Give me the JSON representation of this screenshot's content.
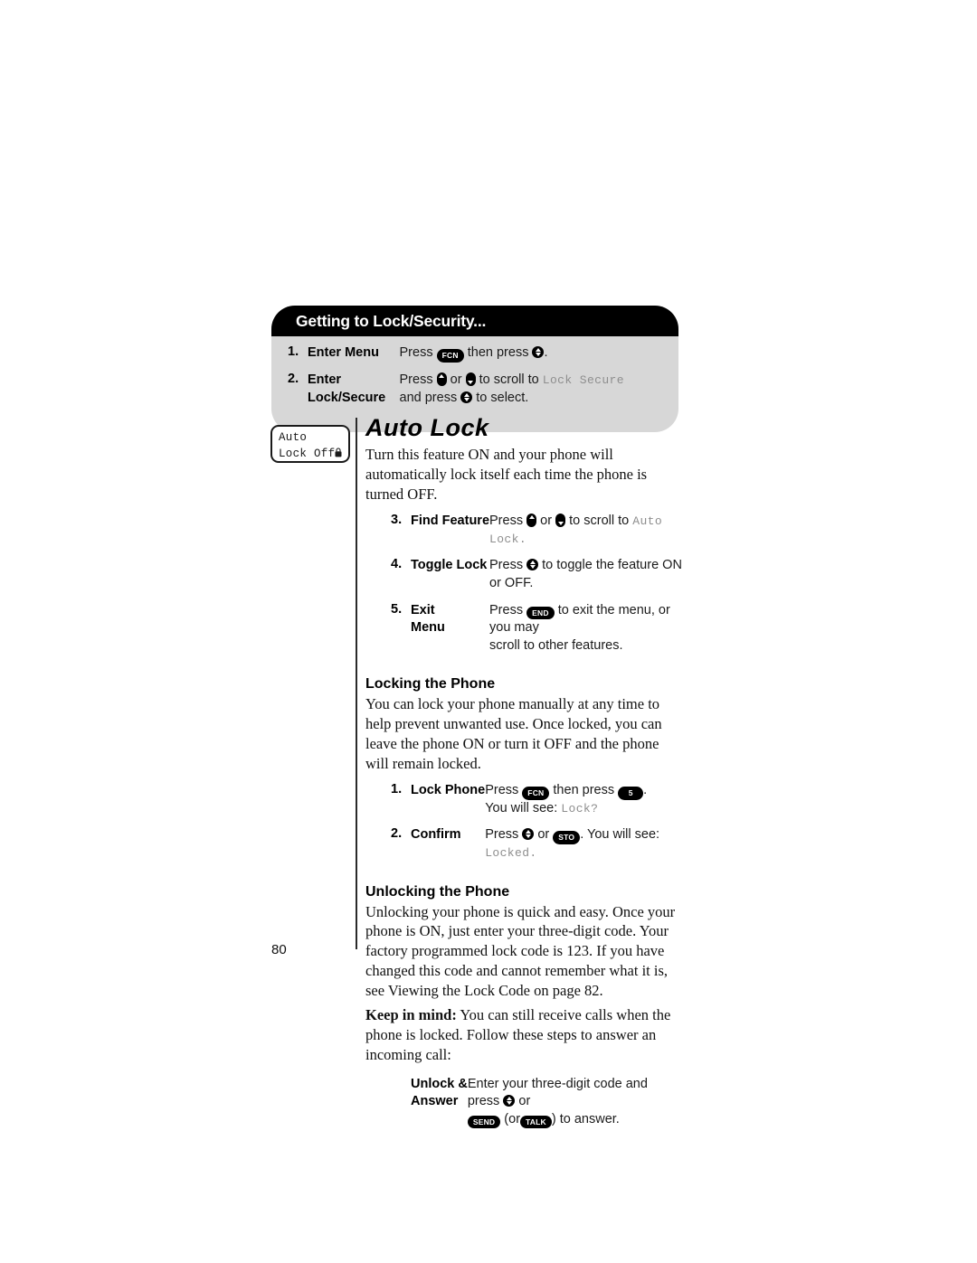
{
  "page": {
    "number": "80"
  },
  "callout": {
    "header": "Getting to Lock/Security...",
    "steps": [
      {
        "num": "1.",
        "label": "Enter Menu",
        "desc_pre": "Press",
        "key1": "FCN",
        "desc_mid": "then press",
        "desc_post": "."
      },
      {
        "num": "2.",
        "label_line1": "Enter",
        "label_line2": "Lock/Secure",
        "desc_pre": "Press",
        "desc_or": "or",
        "desc_scroll": "to scroll to",
        "lcd": "Lock Secure",
        "desc_line2_pre": "and press",
        "desc_line2_post": "to select."
      }
    ]
  },
  "phone_display": {
    "line1": "Auto",
    "line2": "Lock Off",
    "icon": "lock-icon"
  },
  "article": {
    "title": "Auto Lock",
    "intro": "Turn this feature ON and your phone will automatically lock itself each time the phone is turned OFF.",
    "steps": [
      {
        "num": "3.",
        "label": "Find Feature",
        "pre": "Press",
        "or": "or",
        "scroll": "to scroll to",
        "lcd": "Auto Lock",
        "post": "."
      },
      {
        "num": "4.",
        "label": "Toggle Lock",
        "pre": "Press",
        "post": "to toggle the feature ON or OFF."
      },
      {
        "num": "5.",
        "label_line1": "Exit",
        "label_line2": "Menu",
        "pre": "Press",
        "key": "END",
        "post": "to exit the menu, or you may",
        "line2": "scroll to other features."
      }
    ],
    "locking": {
      "heading": "Locking the Phone",
      "body": "You can lock your phone manually at any time to help prevent unwanted use. Once locked, you can leave the phone ON or turn it OFF and the phone will remain locked.",
      "steps": [
        {
          "num": "1.",
          "label": "Lock Phone",
          "pre": "Press",
          "key1": "FCN",
          "mid": "then press",
          "key2": "5",
          "post": ".",
          "line2_pre": "You will see:",
          "line2_lcd": "Lock?"
        },
        {
          "num": "2.",
          "label": "Confirm",
          "pre": "Press",
          "or": "or",
          "key": "STO",
          "mid": ". You will see:",
          "lcd": "Locked",
          "post": "."
        }
      ]
    },
    "unlocking": {
      "heading": "Unlocking the Phone",
      "body": "Unlocking your phone is quick and easy. Once your phone is ON, just enter your three-digit code. Your factory programmed lock code is 123. If you have changed this code and cannot remember what it is, see Viewing the Lock Code on page 82.",
      "keep_in_mind_label": "Keep in mind:",
      "keep_in_mind_body": "You can still receive calls when the phone is locked. Follow these steps to answer an incoming call:",
      "step": {
        "label_line1": "Unlock &",
        "label_line2": "Answer",
        "pre": "Enter your three-digit code and press",
        "or": "or",
        "key_send": "SEND",
        "paren_open": "(or",
        "key_talk": "TALK",
        "paren_close": ") to answer."
      }
    }
  },
  "colors": {
    "header_bg": "#000000",
    "callout_bg": "#d7d7d7",
    "lcd_text": "#8e8e8e",
    "body_text": "#111111"
  }
}
